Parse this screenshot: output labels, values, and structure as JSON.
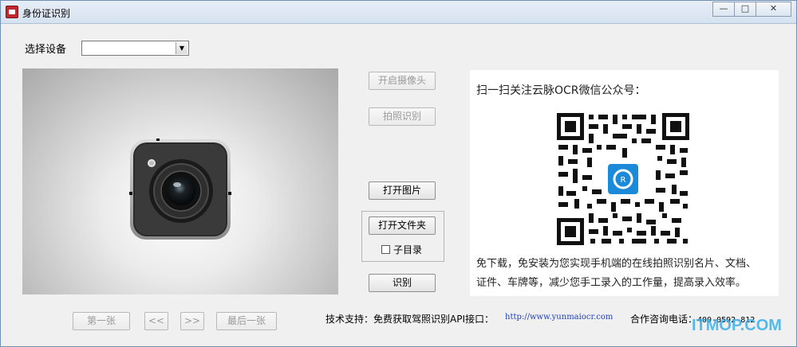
{
  "window": {
    "title": "身份证识别",
    "controls": {
      "minimize": "—",
      "maximize": "□",
      "close": "✕"
    }
  },
  "device": {
    "label": "选择设备",
    "selected": ""
  },
  "preview": {
    "icon": "camera-icon"
  },
  "buttons": {
    "open_camera": "开启摄像头",
    "capture": "拍照识别",
    "open_image": "打开图片",
    "open_folder": "打开文件夹",
    "recognize": "识别"
  },
  "subfolder": {
    "label": "子目录",
    "checked": false
  },
  "navigation": {
    "first": "第一张",
    "prev": "<<",
    "next": ">>",
    "last": "最后一张"
  },
  "qr_panel": {
    "title": "扫一扫关注云脉OCR微信公众号：",
    "line1": "免下载，免安装为您实现手机端的在线拍照识别名片、文档、",
    "line2": "证件、车牌等，减少您手工录入的工作量，提高录入效率。"
  },
  "footer": {
    "support_label": "技术支持：免费获取驾照识别API接口：",
    "link": "http://www.yunmaiocr.com",
    "phone_label": "合作咨询电话：",
    "phone": "400-0592-812"
  },
  "watermark": "ITMOP.COM"
}
